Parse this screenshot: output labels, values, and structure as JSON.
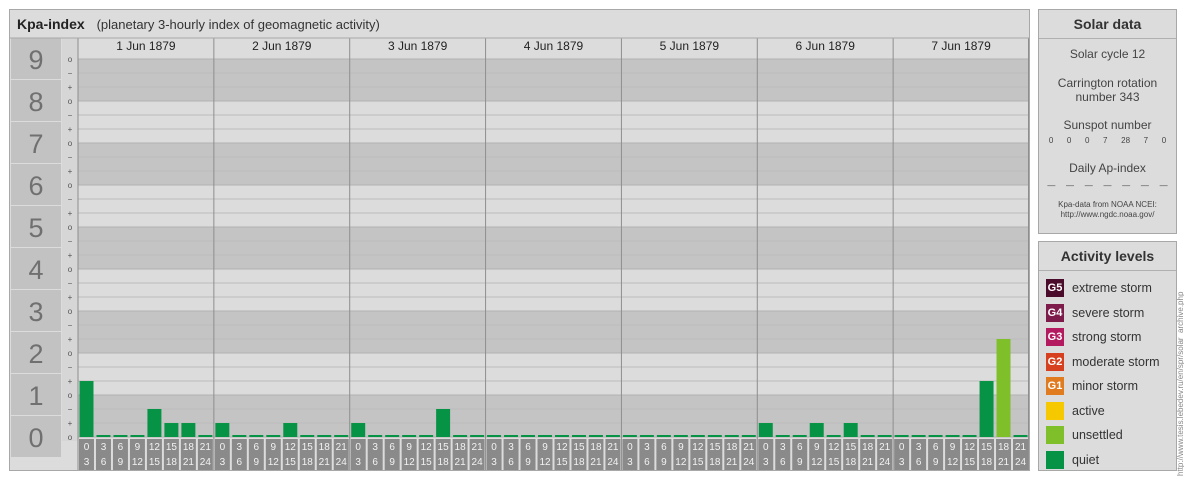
{
  "chart_data": {
    "type": "bar",
    "title": "Kpa-index",
    "subtitle": "(planetary 3-hourly index of geomagnetic activity)",
    "y_labels": [
      "0",
      "1",
      "2",
      "3",
      "4",
      "5",
      "6",
      "7",
      "8",
      "9"
    ],
    "y_sub_labels": [
      "o",
      "+",
      "−"
    ],
    "ylim": [
      0,
      9
    ],
    "days": [
      "1 Jun 1879",
      "2 Jun 1879",
      "3 Jun 1879",
      "4 Jun 1879",
      "5 Jun 1879",
      "6 Jun 1879",
      "7 Jun 1879"
    ],
    "interval_start": [
      "0",
      "3",
      "6",
      "9",
      "12",
      "15",
      "18",
      "21"
    ],
    "interval_end": [
      "3",
      "6",
      "9",
      "12",
      "15",
      "18",
      "21",
      "24"
    ],
    "series": [
      {
        "values": [
          [
            1.333,
            0,
            0,
            0,
            0.667,
            0.333,
            0.333,
            0
          ],
          [
            0.333,
            0,
            0,
            0,
            0.333,
            0,
            0,
            0
          ],
          [
            0.333,
            0,
            0,
            0,
            0,
            0.667,
            0,
            0
          ],
          [
            0,
            0,
            0,
            0,
            0,
            0,
            0,
            0
          ],
          [
            0,
            0,
            0,
            0,
            0,
            0,
            0,
            0
          ],
          [
            0.333,
            0,
            0,
            0.333,
            0,
            0.333,
            0,
            0
          ],
          [
            0,
            0,
            0,
            0,
            0,
            1.333,
            2.333,
            0
          ]
        ]
      }
    ],
    "grid": true,
    "colors": {
      "quiet": "#079345",
      "unsettled": "#7fbf2a",
      "active": "#f6c800",
      "minor": "#e07b20",
      "moderate": "#d7401f",
      "strong": "#b41a5f",
      "severe": "#7d1b4a",
      "extreme": "#4b0b2a",
      "band_dark": "#c4c4c4",
      "band_light": "#dcdcdc",
      "ylabel_bg": "#c2c2c2",
      "ylabel_text": "#707070"
    }
  },
  "solar": {
    "title": "Solar data",
    "cycle": "Solar cycle 12",
    "carrington_line1": "Carrington rotation",
    "carrington_line2": "number 343",
    "sunspot_label": "Sunspot number",
    "sunspots": [
      "0",
      "0",
      "0",
      "7",
      "28",
      "7",
      "0"
    ],
    "ap_label": "Daily Ap-index",
    "ap": [
      "—",
      "—",
      "—",
      "—",
      "—",
      "—",
      "—"
    ],
    "source_line1": "Kpa-data from NOAA NCEI:",
    "source_line2": "http://www.ngdc.noaa.gov/"
  },
  "levels": {
    "title": "Activity levels",
    "items": [
      {
        "badge": "G5",
        "label": "extreme storm",
        "color": "#4b0b2a"
      },
      {
        "badge": "G4",
        "label": "severe storm",
        "color": "#7d1b4a"
      },
      {
        "badge": "G3",
        "label": "strong storm",
        "color": "#b41a5f"
      },
      {
        "badge": "G2",
        "label": "moderate storm",
        "color": "#d7401f"
      },
      {
        "badge": "G1",
        "label": "minor storm",
        "color": "#e07b20"
      },
      {
        "badge": "",
        "label": "active",
        "color": "#f6c800"
      },
      {
        "badge": "",
        "label": "unsettled",
        "color": "#7fbf2a"
      },
      {
        "badge": "",
        "label": "quiet",
        "color": "#079345"
      }
    ]
  },
  "credit": "http://www.tesis.lebedev.ru/en/spr/solar_archive.php"
}
